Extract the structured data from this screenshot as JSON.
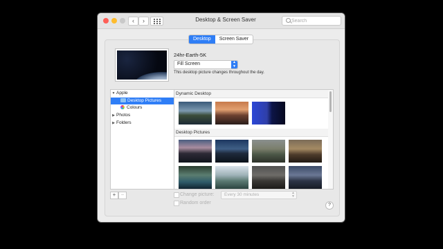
{
  "window": {
    "title": "Desktop & Screen Saver"
  },
  "nav": {
    "back": "‹",
    "forward": "›"
  },
  "search": {
    "placeholder": "Search"
  },
  "tabs": [
    {
      "label": "Desktop",
      "active": true
    },
    {
      "label": "Screen Saver",
      "active": false
    }
  ],
  "current": {
    "name": "24hr-Earth-5K",
    "fill_mode": "Fill Screen",
    "description": "This desktop picture changes throughout the day."
  },
  "sidebar": {
    "items": [
      {
        "label": "Apple",
        "toggle": "▼"
      },
      {
        "label": "Desktop Pictures",
        "selected": true
      },
      {
        "label": "Colours"
      },
      {
        "label": "Photos",
        "toggle": "▶"
      },
      {
        "label": "Folders",
        "toggle": "▶"
      }
    ]
  },
  "sections": {
    "dynamic": "Dynamic Desktop",
    "pictures": "Desktop Pictures"
  },
  "buttons": {
    "add": "+",
    "remove": "−",
    "help": "?"
  },
  "options": {
    "change_picture": "Change picture:",
    "interval": "Every 30 minutes",
    "random_order": "Random order"
  },
  "colors": {
    "accent": "#2f7ef6",
    "close": "#fe5f57",
    "minimize": "#febc2e",
    "zoom": "#28c840"
  }
}
